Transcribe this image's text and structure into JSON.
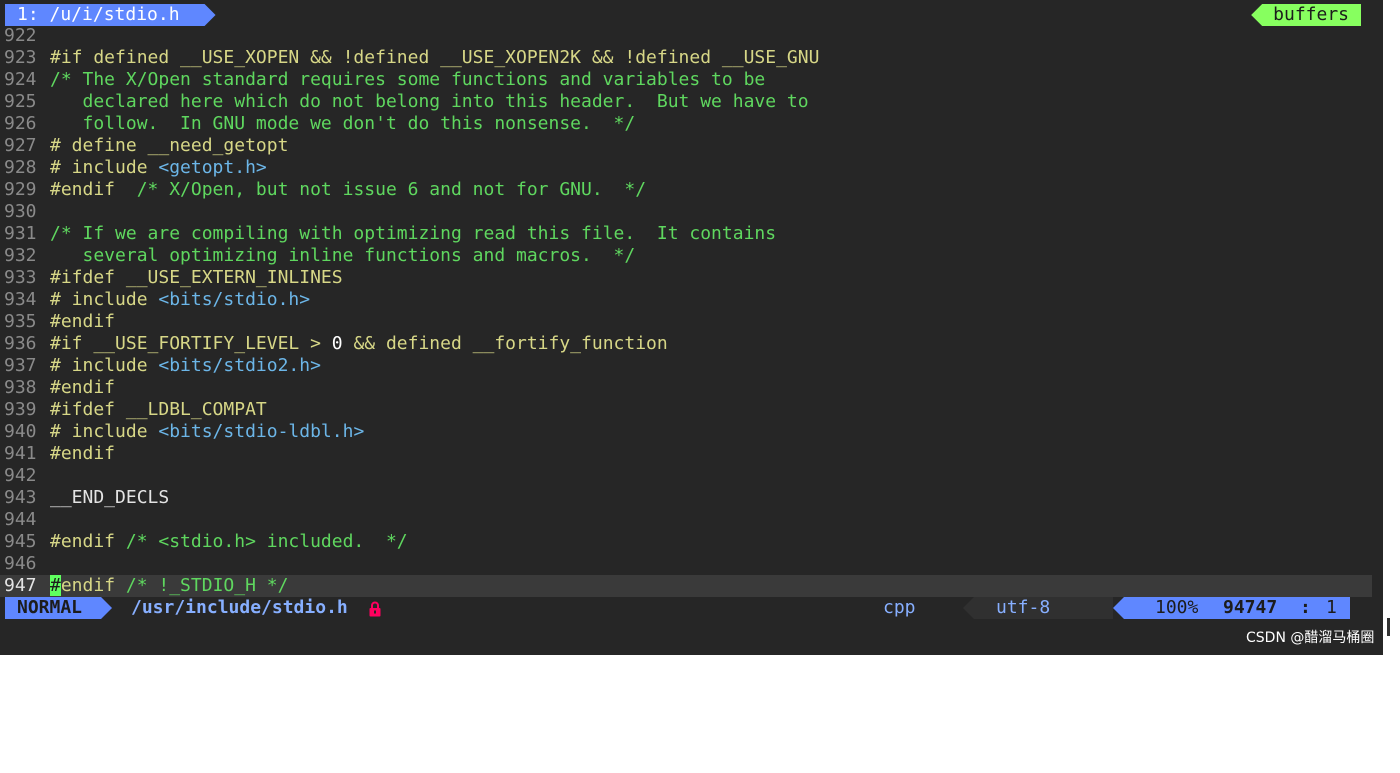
{
  "tabline": {
    "active_tab": "1: /u/i/stdio.h",
    "buffers_label": "buffers"
  },
  "editor": {
    "lines": [
      {
        "n": "922",
        "segs": []
      },
      {
        "n": "923",
        "segs": [
          [
            "pp",
            "#if defined __USE_XOPEN && !defined __USE_XOPEN2K && !defined __USE_GNU"
          ]
        ]
      },
      {
        "n": "924",
        "segs": [
          [
            "cm",
            "/* The X/Open standard requires some functions and variables to be"
          ]
        ]
      },
      {
        "n": "925",
        "segs": [
          [
            "cm",
            "   declared here which do not belong into this header.  But we have to"
          ]
        ]
      },
      {
        "n": "926",
        "segs": [
          [
            "cm",
            "   follow.  In GNU mode we don't do this nonsense.  */"
          ]
        ]
      },
      {
        "n": "927",
        "segs": [
          [
            "pp",
            "# define __need_getopt"
          ]
        ]
      },
      {
        "n": "928",
        "segs": [
          [
            "pp",
            "# include "
          ],
          [
            "inc",
            "<getopt.h>"
          ]
        ]
      },
      {
        "n": "929",
        "segs": [
          [
            "pp",
            "#endif  "
          ],
          [
            "cm",
            "/* X/Open, but not issue 6 and not for GNU.  */"
          ]
        ]
      },
      {
        "n": "930",
        "segs": []
      },
      {
        "n": "931",
        "segs": [
          [
            "cm",
            "/* If we are compiling with optimizing read this file.  It contains"
          ]
        ]
      },
      {
        "n": "932",
        "segs": [
          [
            "cm",
            "   several optimizing inline functions and macros.  */"
          ]
        ]
      },
      {
        "n": "933",
        "segs": [
          [
            "pp",
            "#ifdef __USE_EXTERN_INLINES"
          ]
        ]
      },
      {
        "n": "934",
        "segs": [
          [
            "pp",
            "# include "
          ],
          [
            "inc",
            "<bits/stdio.h>"
          ]
        ]
      },
      {
        "n": "935",
        "segs": [
          [
            "pp",
            "#endif"
          ]
        ]
      },
      {
        "n": "936",
        "segs": [
          [
            "pp",
            "#if __USE_FORTIFY_LEVEL > "
          ],
          [
            "num",
            "0"
          ],
          [
            "pp",
            " && defined __fortify_function"
          ]
        ]
      },
      {
        "n": "937",
        "segs": [
          [
            "pp",
            "# include "
          ],
          [
            "inc",
            "<bits/stdio2.h>"
          ]
        ]
      },
      {
        "n": "938",
        "segs": [
          [
            "pp",
            "#endif"
          ]
        ]
      },
      {
        "n": "939",
        "segs": [
          [
            "pp",
            "#ifdef __LDBL_COMPAT"
          ]
        ]
      },
      {
        "n": "940",
        "segs": [
          [
            "pp",
            "# include "
          ],
          [
            "inc",
            "<bits/stdio-ldbl.h>"
          ]
        ]
      },
      {
        "n": "941",
        "segs": [
          [
            "pp",
            "#endif"
          ]
        ]
      },
      {
        "n": "942",
        "segs": []
      },
      {
        "n": "943",
        "segs": [
          [
            "plain",
            "__END_DECLS"
          ]
        ]
      },
      {
        "n": "944",
        "segs": []
      },
      {
        "n": "945",
        "segs": [
          [
            "pp",
            "#endif "
          ],
          [
            "cm",
            "/* <stdio.h> included.  */"
          ]
        ]
      },
      {
        "n": "946",
        "segs": []
      },
      {
        "n": "947",
        "segs": [
          [
            "cursor",
            "#"
          ],
          [
            "pp",
            "endif "
          ],
          [
            "cm",
            "/* !_STDIO_H */"
          ]
        ],
        "current": true
      }
    ]
  },
  "statusline": {
    "mode": "NORMAL",
    "filepath": "/usr/include/stdio.h",
    "filetype": "cpp",
    "encoding": "utf-8",
    "percent": "100%",
    "line": "94747",
    "separator": ":",
    "column": "1"
  },
  "colors": {
    "background": "#262626",
    "preproc": "#d7d787",
    "comment": "#5fd75f",
    "include_path": "#6cb6e8",
    "mode_accent": "#5f87ff",
    "buffers_accent": "#87ff5f",
    "readonly_lock": "#ff005f"
  },
  "watermark": "CSDN @醋溜马桶圈"
}
